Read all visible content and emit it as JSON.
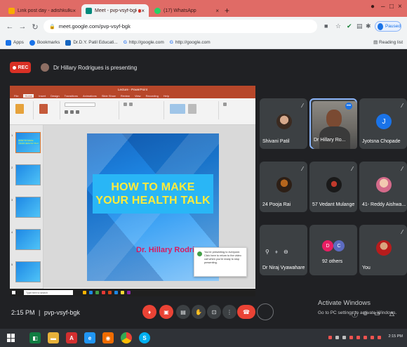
{
  "browser": {
    "tabs": [
      {
        "title": "Link post day - adishkulkarni@",
        "active": false
      },
      {
        "title": "Meet - pvp-vsyf-bgk",
        "active": true
      },
      {
        "title": "(17) WhatsApp",
        "active": false
      }
    ],
    "new_tab_symbol": "+",
    "url": "meet.google.com/pvp-vsyf-bgk",
    "profile_status": "Paused",
    "bookmarks": [
      {
        "label": "Apps"
      },
      {
        "label": "Bookmarks"
      },
      {
        "label": "Dr.D.Y. Patil Educati..."
      },
      {
        "label": "http://google.com"
      },
      {
        "label": "http://google.com"
      }
    ],
    "reading_list": "Reading list"
  },
  "meet": {
    "rec_label": "REC",
    "presenting_text": "Dr Hillary Rodrigues is presenting",
    "time": "2:15 PM",
    "meeting_code": "pvp-vsyf-bgk",
    "separator": "|",
    "activate_title": "Activate Windows",
    "activate_sub": "Go to PC settings to activate Windows."
  },
  "presentation": {
    "app_title": "Lecture - PowerPoint",
    "ribbon_tabs": [
      "File",
      "Home",
      "Insert",
      "Design",
      "Transitions",
      "Animations",
      "Slide Show",
      "Review",
      "View",
      "Recording",
      "Help"
    ],
    "thumb_label": "HOW TO MAKE YOUR HEALTH TALK",
    "slide_title_line1": "HOW TO MAKE",
    "slide_title_line2": "YOUR HEALTH TALK",
    "slide_author": "Dr. Hillary Rodrigues",
    "toast_text": "You're presenting to everyone. Click here to return to the video call when you're ready to stop presenting.",
    "taskbar_search": "Type here to search"
  },
  "participants": [
    {
      "name": "Shivani Patil",
      "muted": true,
      "avatar": "photo"
    },
    {
      "name": "Dr Hillary Ro...",
      "muted": false,
      "avatar": "camera"
    },
    {
      "name": "Jyotsna Chopade",
      "muted": true,
      "avatar": "J"
    },
    {
      "name": "24 Pooja Rai",
      "muted": true,
      "avatar": "photo"
    },
    {
      "name": "57 Vedant Mulange",
      "muted": true,
      "avatar": "photo"
    },
    {
      "name": "41- Reddy Aishwa...",
      "muted": true,
      "avatar": "photo"
    },
    {
      "name": "Dr Niraj Vyawahare",
      "muted": false,
      "avatar": "none"
    },
    {
      "name": "92 others",
      "muted": false,
      "avatar": "group",
      "initials": [
        "D",
        "C"
      ]
    },
    {
      "name": "You",
      "muted": true,
      "avatar": "photo"
    }
  ],
  "colors": {
    "tab_strip": "#e06b66",
    "meet_bg": "#202124",
    "tile_bg": "#3c4043",
    "end_call": "#ea4335",
    "rec_red": "#d93025",
    "slide_banner": "#29b6f6",
    "slide_text": "#ffeb3b",
    "author_text": "#d81b60"
  },
  "icons": {
    "controls": [
      "mic-off-icon",
      "camera-off-icon",
      "captions-icon",
      "raise-hand-icon",
      "present-icon",
      "more-options-icon",
      "end-call-icon"
    ],
    "side": [
      "info-icon",
      "people-icon",
      "chat-icon",
      "activities-icon"
    ]
  }
}
